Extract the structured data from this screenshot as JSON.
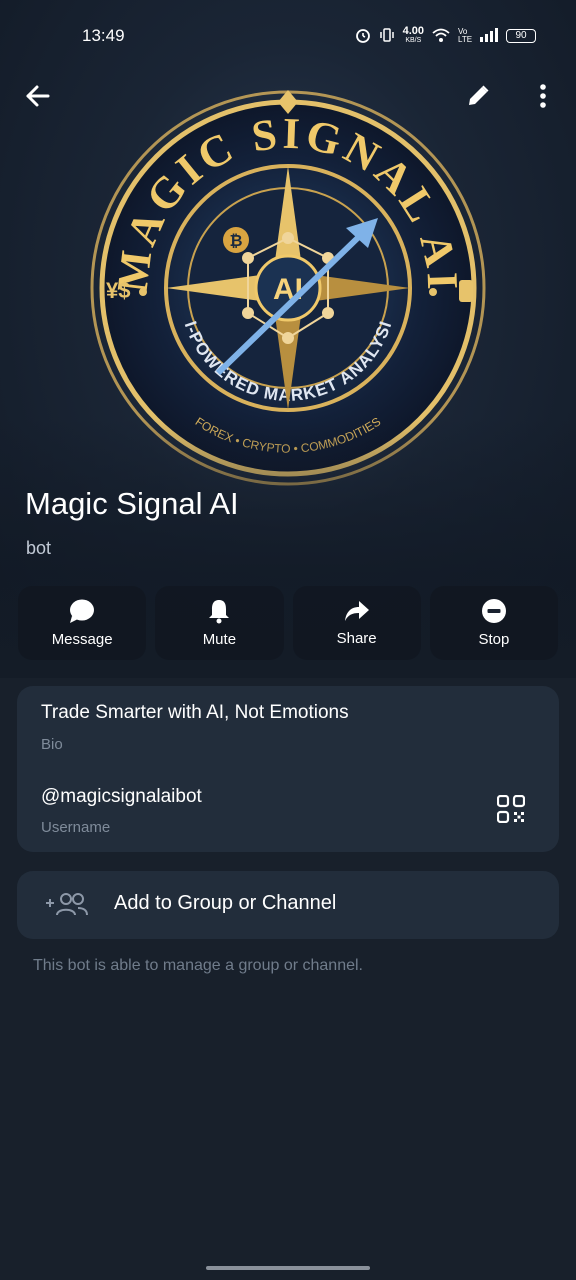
{
  "status_bar": {
    "time": "13:49",
    "network_speed": "4.00",
    "network_unit": "KB/S",
    "network_type": "Vo LTE",
    "battery": "90",
    "icons": [
      "alarm-icon",
      "vibrate-icon",
      "wifi-icon",
      "signal-icon",
      "battery-icon"
    ]
  },
  "toolbar": {
    "back_icon": "arrow-left-icon",
    "edit_icon": "pencil-icon",
    "more_icon": "more-vertical-icon"
  },
  "logo": {
    "top_text": "MAGIC SIGNAL AI",
    "inner_text": "AI-POWERED MARKET ANALYSIS",
    "center_text": "AI",
    "left_symbol": "¥$",
    "ring_labels": [
      "FOREX",
      "CRYPTO",
      "COMMODITIES"
    ]
  },
  "profile": {
    "name": "Magic Signal AI",
    "subtitle": "bot"
  },
  "actions": [
    {
      "label": "Message",
      "icon": "chat-bubble-icon"
    },
    {
      "label": "Mute",
      "icon": "bell-icon"
    },
    {
      "label": "Share",
      "icon": "share-arrow-icon"
    },
    {
      "label": "Stop",
      "icon": "stop-circle-icon"
    }
  ],
  "info": {
    "bio": "Trade Smarter with AI, Not Emotions",
    "bio_label": "Bio",
    "username": "@magicsignalaibot",
    "username_label": "Username",
    "qr_icon": "qr-code-icon"
  },
  "add_group": {
    "label": "Add to Group or Channel",
    "icon": "add-users-icon"
  },
  "hint": "This bot is able to manage a group or channel.",
  "colors": {
    "background": "#18202b",
    "card": "#222d3b",
    "gold": "#d9b25c",
    "muted_text": "#7f8b9a"
  }
}
